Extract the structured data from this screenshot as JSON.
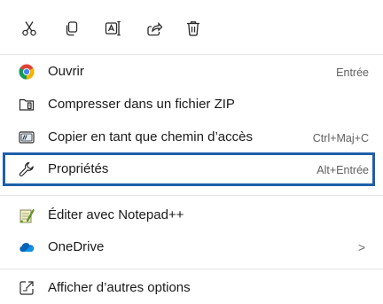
{
  "toolbar": {
    "buttons": [
      {
        "name": "cut-icon"
      },
      {
        "name": "copy-icon"
      },
      {
        "name": "rename-icon"
      },
      {
        "name": "share-icon"
      },
      {
        "name": "delete-icon"
      }
    ]
  },
  "items": [
    {
      "label": "Ouvrir",
      "shortcut": "Entrée",
      "icon": "chrome-icon"
    },
    {
      "label": "Compresser dans un fichier ZIP",
      "shortcut": "",
      "icon": "zip-folder-icon"
    },
    {
      "label": "Copier en tant que chemin d’accès",
      "shortcut": "Ctrl+Maj+C",
      "icon": "copy-path-icon"
    },
    {
      "label": "Propriétés",
      "shortcut": "Alt+Entrée",
      "icon": "wrench-icon",
      "highlighted": true
    },
    {
      "label": "Éditer avec Notepad++",
      "shortcut": "",
      "icon": "notepad-plus-plus-icon"
    },
    {
      "label": "OneDrive",
      "shortcut": "",
      "icon": "onedrive-icon",
      "submenu_arrow": ">"
    },
    {
      "label": "Afficher d’autres options",
      "shortcut": "",
      "icon": "more-options-icon"
    }
  ],
  "colors": {
    "highlight_border": "#1e5fa8",
    "chrome_red": "#db4437",
    "chrome_yellow": "#f4b400",
    "chrome_green": "#0f9d58",
    "chrome_blue": "#4285f4",
    "onedrive_blue": "#0364b8"
  }
}
